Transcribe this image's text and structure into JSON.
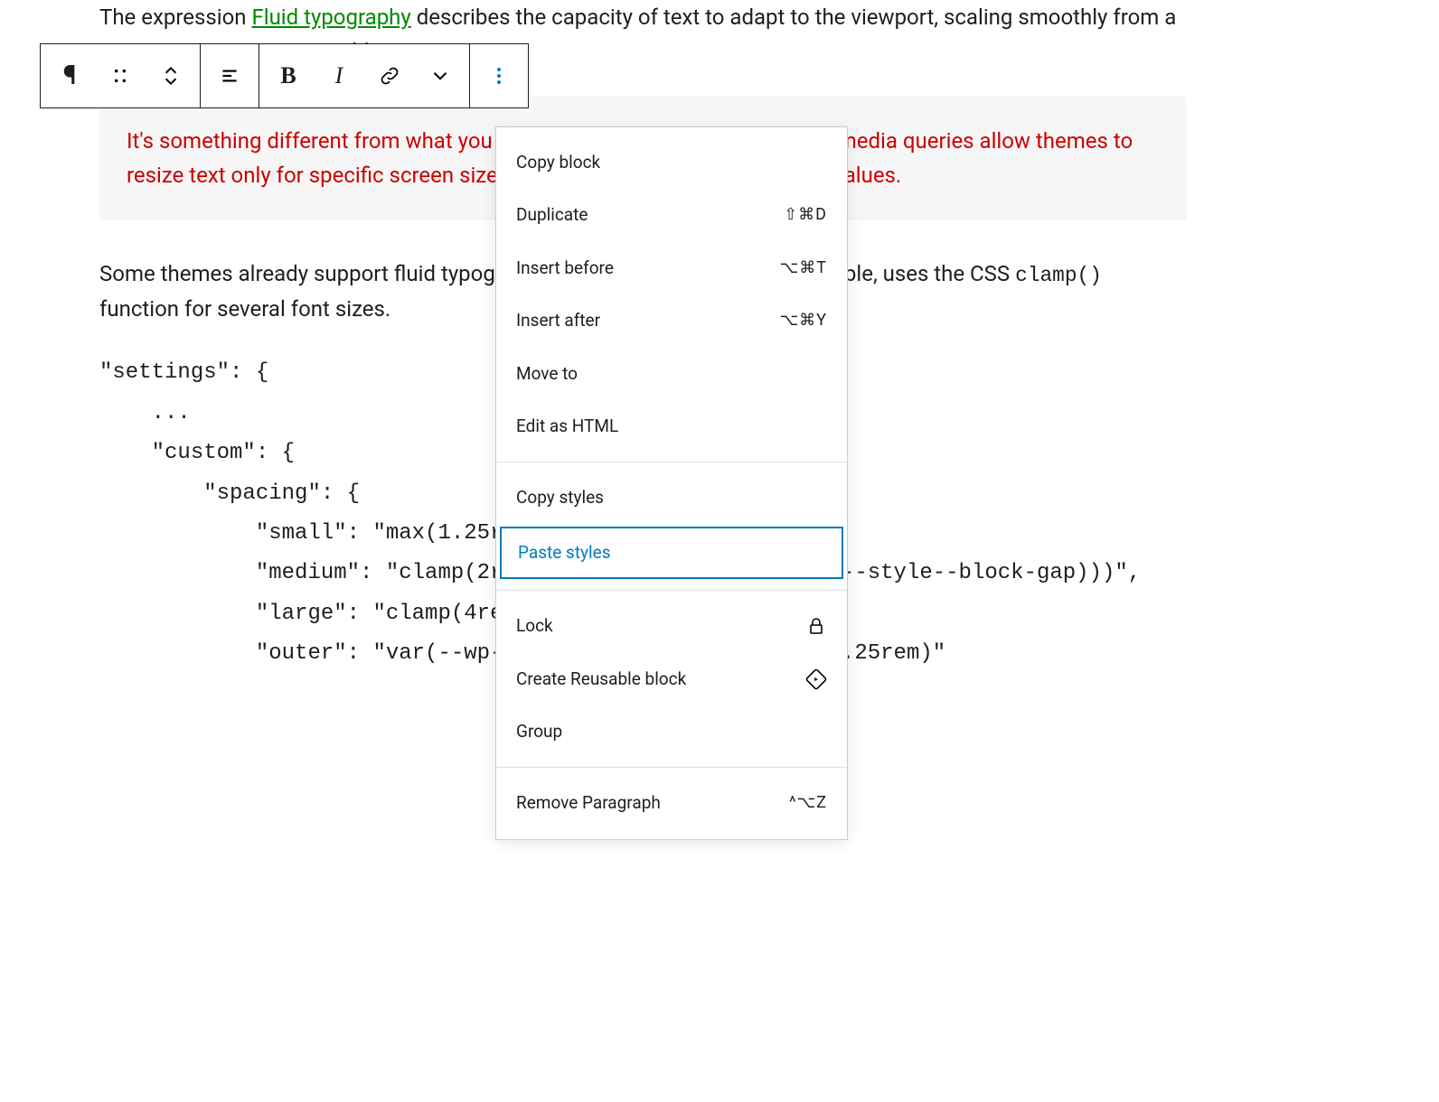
{
  "content": {
    "para1_prefix": "The expression ",
    "para1_link": "Fluid typography",
    "para1_suffix": " describes the capacity of text to adapt to the viewport, scaling smoothly from a minimum to maximum width.",
    "highlight": "It's something different from what you can achieve with media queries, as media queries allow themes to resize text only for specific screen sizes but do nothing between different values.",
    "para3_prefix": "Some themes already support fluid typography. Twenty Twenty-Two, for example, uses the CSS ",
    "para3_code": "clamp()",
    "para3_suffix": " function for several font sizes.",
    "code_block": "\"settings\": {\n    ...\n    \"custom\": {\n        \"spacing\": {\n            \"small\": \"max(1.25rem, 5vw)\",\n            \"medium\": \"clamp(2rem, 8vw, calc(4 * var(--wp--style--block-gap)))\",\n            \"large\": \"clamp(4rem, 10vw, 8rem)\",\n            \"outer\": \"var(--wp--custom--spacing--small, 1.25rem)\""
  },
  "toolbar": {
    "paragraph_icon": "¶",
    "bold_label": "B",
    "italic_label": "I"
  },
  "menu": {
    "section1": [
      {
        "label": "Copy block",
        "shortcut": ""
      },
      {
        "label": "Duplicate",
        "shortcut": "⇧⌘D"
      },
      {
        "label": "Insert before",
        "shortcut": "⌥⌘T"
      },
      {
        "label": "Insert after",
        "shortcut": "⌥⌘Y"
      },
      {
        "label": "Move to",
        "shortcut": ""
      },
      {
        "label": "Edit as HTML",
        "shortcut": ""
      }
    ],
    "section2": [
      {
        "label": "Copy styles",
        "shortcut": ""
      },
      {
        "label": "Paste styles",
        "shortcut": "",
        "highlighted": true
      }
    ],
    "section3": [
      {
        "label": "Lock",
        "icon": "lock"
      },
      {
        "label": "Create Reusable block",
        "icon": "reusable"
      },
      {
        "label": "Group",
        "shortcut": ""
      }
    ],
    "section4": [
      {
        "label": "Remove Paragraph",
        "shortcut": "^⌥Z"
      }
    ]
  }
}
